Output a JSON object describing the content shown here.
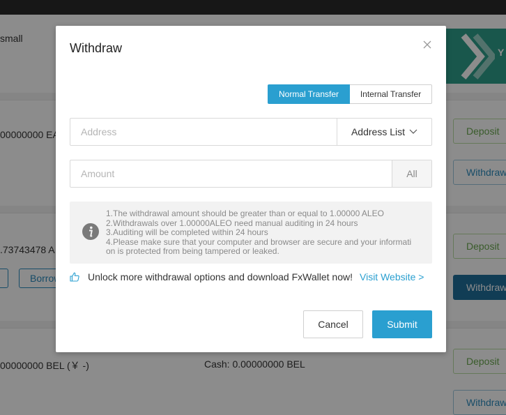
{
  "background": {
    "top_text": "small",
    "rows": [
      {
        "balance": "00000000 EA",
        "deposit": "Deposit",
        "withdraw": "Withdraw"
      },
      {
        "balance": ".73743478 A",
        "deposit": "Deposit",
        "withdraw": "Withdraw",
        "borrow": "Borrow"
      },
      {
        "balance": "00000000 BEL (￥ -)",
        "cash": "Cash: 0.00000000 BEL",
        "deposit": "Deposit",
        "withdraw": "Withdraw"
      }
    ],
    "banner_text": "Y"
  },
  "modal": {
    "title": "Withdraw",
    "tabs": {
      "normal": "Normal Transfer",
      "internal": "Internal Transfer"
    },
    "address": {
      "placeholder": "Address",
      "value": "",
      "list_label": "Address List"
    },
    "amount": {
      "placeholder": "Amount",
      "value": "",
      "all_label": "All"
    },
    "notice": [
      "1.The withdrawal amount should be greater than or equal to 1.00000 ALEO",
      "2.Withdrawals over 1.00000ALEO need manual auditing in 24 hours",
      "3.Auditing will be completed within 24 hours",
      "4.Please make sure that your computer and browser are secure and your informati",
      "on is protected from being tampered or leaked."
    ],
    "promo": {
      "text": "Unlock more withdrawal options and download FxWallet now!",
      "link": "Visit Website >"
    },
    "cancel_label": "Cancel",
    "submit_label": "Submit"
  },
  "colors": {
    "accent": "#2a9fd0",
    "deposit": "#6aa84f",
    "overlay": "rgba(0,0,0,0.45)"
  }
}
